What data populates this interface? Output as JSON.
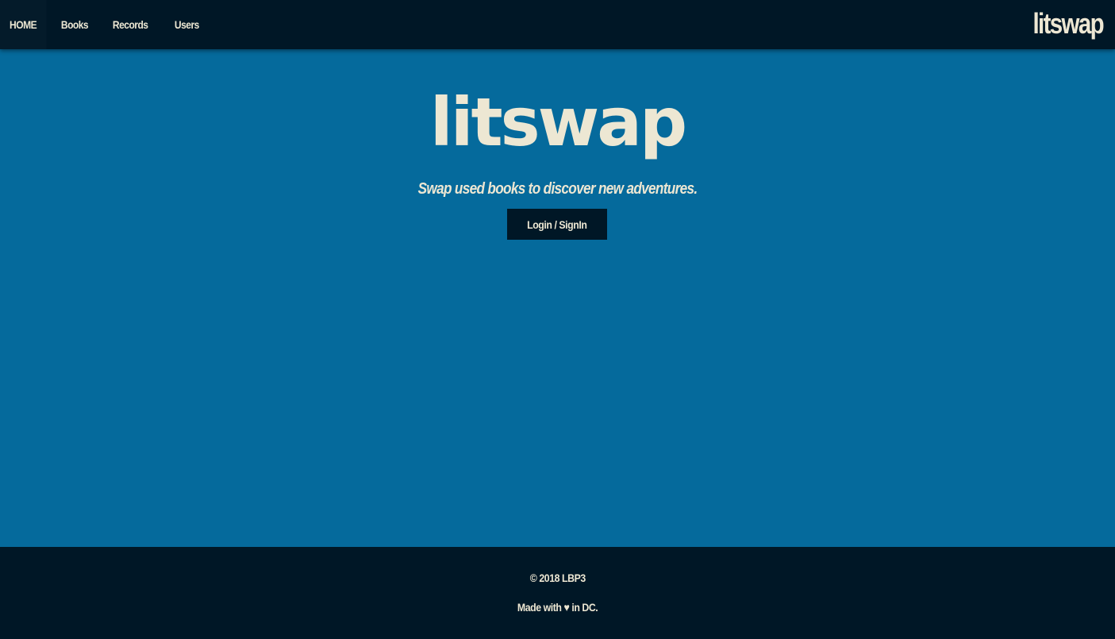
{
  "navbar": {
    "links": [
      {
        "label": "HOME",
        "active": true
      },
      {
        "label": "Books",
        "active": false
      },
      {
        "label": "Records",
        "active": false
      },
      {
        "label": "Users",
        "active": false
      }
    ],
    "brand": "litswap"
  },
  "hero": {
    "logo": "litswap",
    "tagline": "Swap used books to discover new adventures.",
    "login_label": "Login / SignIn"
  },
  "footer": {
    "copyright": "© 2018 LBP3",
    "made_prefix": "Made with",
    "heart": "♥",
    "made_suffix": "in DC."
  },
  "colors": {
    "background": "#056a9c",
    "dark": "#001726",
    "text": "#ede7d3"
  },
  "icons": {
    "heart": "heart-icon"
  }
}
